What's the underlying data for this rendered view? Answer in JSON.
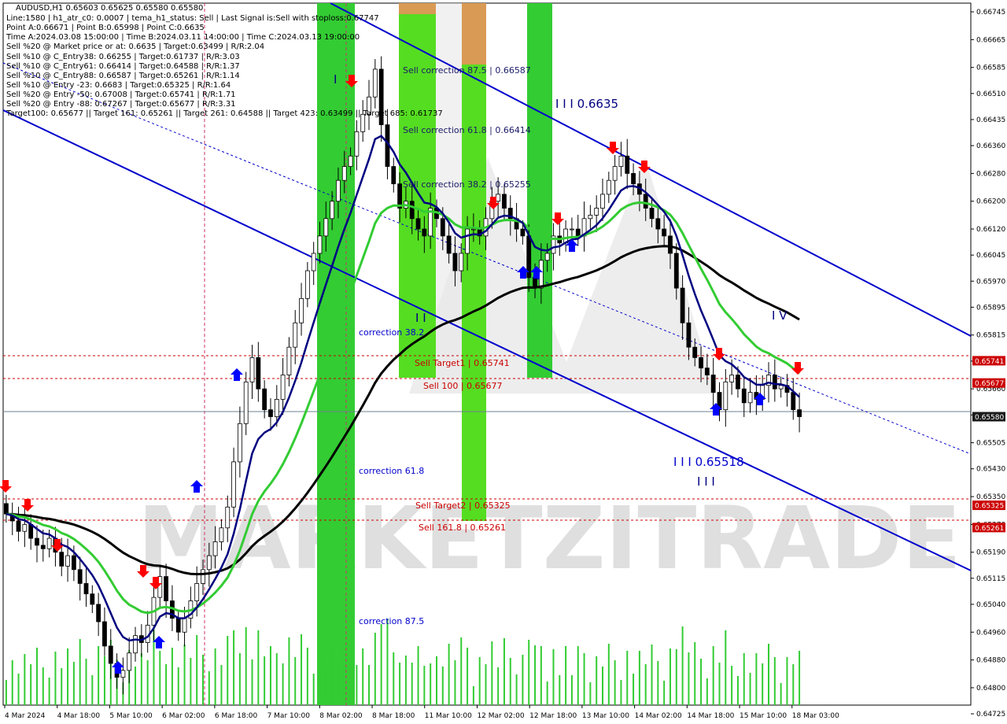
{
  "symbol_line": "AUDUSD,H1  0.65603 0.65625 0.65580 0.65580",
  "info_lines": [
    "Line:1580 | h1_atr_c0: 0.0007 | tema_h1_status: Sell | Last Signal is:Sell with stoploss:0.67747",
    "Point A:0.66671 | Point B:0.65998 | Point C:0.6635",
    "Time A:2024.03.08 15:00:00 | Time B:2024.03.11 14:00:00 | Time C:2024.03.13 19:00:00",
    "Sell %20 @ Market price or at: 0.6635 | Target:0.63499 | R/R:2.04",
    "Sell %10 @ C_Entry38: 0.66255 | Target:0.61737 | R/R:3.03",
    "Sell %10 @ C_Entry61: 0.66414 | Target:0.64588 | R/R:1.37",
    "Sell %10 @ C_Entry88: 0.66587 | Target:0.65261 | R/R:1.14",
    "Sell %10 @ Entry -23: 0.6683 | Target:0.65325 | R/R:1.64",
    "Sell %20 @ Entry -50: 0.67008 | Target:0.65741 | R/R:1.71",
    "Sell %20 @ Entry -88: 0.67267 | Target:0.65677 | R/R:3.31",
    "Target100: 0.65677 || Target 161: 0.65261 || Target 261: 0.64588 || Target 423: 0.63499 || Target 685: 0.61737"
  ],
  "watermark": "MARKETZITRADE",
  "colors": {
    "bull_zone": "#33cc33",
    "bull_zone_light": "#66dd33",
    "zone_top": "#d99a55",
    "channel": "#0000cc",
    "ema_fast": "#000080",
    "ema_mid": "#33cc33",
    "ema_slow": "#000000",
    "level_line": "#cc0000",
    "current_price": "#708090",
    "volume": "#33cc33",
    "sell_arrow": "#ff0000",
    "buy_arrow": "#0000ff"
  },
  "annotations": {
    "sell_corr_875": "Sell correction 87.5 | 0.66587",
    "sell_corr_618": "Sell correction 61.8 | 0.66414",
    "sell_corr_382": "Sell correction 38.2 | 0.65255",
    "corr_382": "correction 38.2",
    "corr_618": "correction 61.8",
    "corr_875": "correction 87.5",
    "sell_target1": "Sell Target1 | 0.65741",
    "sell_100": "Sell 100 | 0.65677",
    "sell_target2": "Sell Target2 | 0.65325",
    "sell_1618": "Sell 161.8 | 0.65261",
    "wave_i": "I",
    "wave_ii": "I I",
    "wave_iii_top": "I I I 0.6635",
    "wave_iii_bottom": "I I I 0.65518",
    "wave_iii_small": "I I I",
    "wave_iv": "I V"
  },
  "chart_data": {
    "type": "candlestick",
    "symbol": "AUDUSD",
    "timeframe": "H1",
    "ohlc_last": {
      "open": 0.65603,
      "high": 0.65625,
      "low": 0.6558,
      "close": 0.6558
    },
    "ylim": [
      0.6475,
      0.6677
    ],
    "y_ticks": [
      "0.66745",
      "0.66665",
      "0.66585",
      "0.66510",
      "0.66435",
      "0.66360",
      "0.66280",
      "0.66200",
      "0.66120",
      "0.66045",
      "0.65970",
      "0.65895",
      "0.65815",
      "0.65740",
      "0.65660",
      "0.65585",
      "0.65505",
      "0.65430",
      "0.65350",
      "0.65270",
      "0.65190",
      "0.65115",
      "0.65040",
      "0.64960",
      "0.64880",
      "0.64800",
      "0.64725"
    ],
    "x_ticks": [
      "4 Mar 2024",
      "4 Mar 18:00",
      "5 Mar 10:00",
      "6 Mar 02:00",
      "6 Mar 18:00",
      "7 Mar 10:00",
      "8 Mar 02:00",
      "8 Mar 18:00",
      "11 Mar 10:00",
      "12 Mar 02:00",
      "12 Mar 18:00",
      "13 Mar 10:00",
      "14 Mar 02:00",
      "14 Mar 18:00",
      "15 Mar 10:00",
      "18 Mar 03:00"
    ],
    "price_levels": [
      {
        "label": "0.65741",
        "value": 0.65741
      },
      {
        "label": "0.65677",
        "value": 0.65677
      },
      {
        "label": "0.65580",
        "value": 0.6558
      },
      {
        "label": "0.65325",
        "value": 0.65325
      },
      {
        "label": "0.65261",
        "value": 0.65261
      }
    ],
    "closes": [
      0.653,
      0.6528,
      0.6525,
      0.6527,
      0.6523,
      0.6521,
      0.652,
      0.6523,
      0.6519,
      0.6515,
      0.6518,
      0.6514,
      0.651,
      0.6507,
      0.6504,
      0.6499,
      0.6492,
      0.6487,
      0.6483,
      0.6485,
      0.649,
      0.6495,
      0.6493,
      0.6498,
      0.6506,
      0.6512,
      0.6505,
      0.65,
      0.6496,
      0.65,
      0.6505,
      0.651,
      0.6514,
      0.6518,
      0.6522,
      0.6526,
      0.6532,
      0.6545,
      0.6556,
      0.6568,
      0.6575,
      0.6566,
      0.656,
      0.6558,
      0.6563,
      0.657,
      0.6578,
      0.6585,
      0.6592,
      0.66,
      0.6605,
      0.661,
      0.6615,
      0.662,
      0.6626,
      0.663,
      0.6633,
      0.664,
      0.6645,
      0.665,
      0.6658,
      0.6642,
      0.663,
      0.6625,
      0.6618,
      0.662,
      0.6615,
      0.6612,
      0.661,
      0.6618,
      0.6615,
      0.661,
      0.6605,
      0.66,
      0.6605,
      0.6612,
      0.6612,
      0.661,
      0.6615,
      0.662,
      0.6622,
      0.6618,
      0.6615,
      0.6612,
      0.661,
      0.6598,
      0.6595,
      0.6603,
      0.6605,
      0.661,
      0.6608,
      0.6612,
      0.6612,
      0.661,
      0.6615,
      0.6616,
      0.6618,
      0.6622,
      0.6626,
      0.663,
      0.6633,
      0.6628,
      0.6625,
      0.6622,
      0.6618,
      0.6615,
      0.6612,
      0.661,
      0.6605,
      0.6595,
      0.6585,
      0.6578,
      0.6575,
      0.6572,
      0.657,
      0.6565,
      0.656,
      0.6568,
      0.657,
      0.6566,
      0.6562,
      0.6565,
      0.6563,
      0.6567,
      0.657,
      0.6566,
      0.6567,
      0.6565,
      0.656,
      0.6558
    ]
  }
}
